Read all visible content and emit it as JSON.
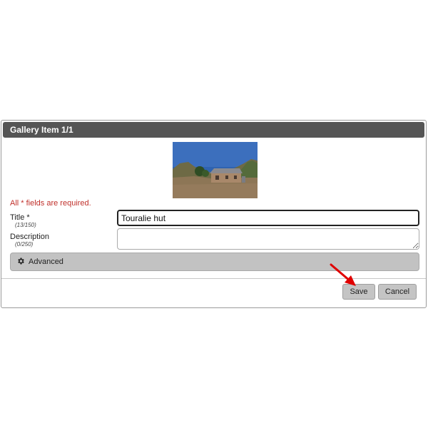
{
  "dialog": {
    "title": "Gallery Item 1/1",
    "image_alt": "stone hut photo"
  },
  "form": {
    "required_note": "All * fields are required.",
    "title_label": "Title *",
    "title_counter": "(13/150)",
    "title_value": "Touralie hut",
    "description_label": "Description",
    "description_counter": "(0/250)",
    "description_value": ""
  },
  "advanced": {
    "label": "Advanced",
    "icon": "gear-icon"
  },
  "buttons": {
    "save_label": "Save",
    "cancel_label": "Cancel"
  },
  "colors": {
    "header_bg": "#555555",
    "required_text": "#c0302b",
    "annotation_arrow": "#e00000"
  }
}
